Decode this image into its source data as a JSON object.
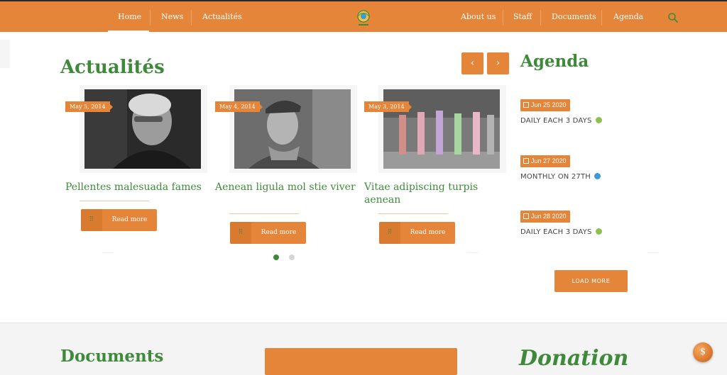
{
  "colors": {
    "brand_orange": "#e5853a",
    "title_green": "#3f8a3a",
    "dot_green": "#8fbf4f",
    "dot_blue": "#3e9ad1"
  },
  "nav": {
    "left": [
      "Home",
      "News",
      "Actualités"
    ],
    "right": [
      "About us",
      "Staff",
      "Documents",
      "Agenda"
    ],
    "search_icon": "search-icon",
    "logo_icon": "emblem-logo"
  },
  "news": {
    "title": "Actualités",
    "prev_icon": "chevron-left-icon",
    "next_icon": "chevron-right-icon",
    "prev_glyph": "‹",
    "next_glyph": "›",
    "cards": [
      {
        "date": "May 5, 2014",
        "title": "Pellentes malesuada fames",
        "button": "Read more"
      },
      {
        "date": "May 4, 2014",
        "title": "Aenean ligula mol stie viver",
        "button": "Read more"
      },
      {
        "date": "May 3, 2014",
        "title": "Vitae adipiscing turpis aenean",
        "button": "Read more"
      }
    ],
    "carousel_pages": 2,
    "active_page": 1
  },
  "agenda": {
    "title": "Agenda",
    "events": [
      {
        "date": "Jun 25 2020",
        "recurrence": "DAILY EACH 3 DAYS",
        "dot_color": "#8fbf4f"
      },
      {
        "date": "Jun 27 2020",
        "recurrence": "MONTHLY ON 27TH",
        "dot_color": "#3e9ad1"
      },
      {
        "date": "Jun 28 2020",
        "recurrence": "DAILY EACH 3 DAYS",
        "dot_color": "#8fbf4f"
      }
    ],
    "load_more": "LOAD MORE"
  },
  "bottom": {
    "documents_title": "Documents",
    "donation_title": "Donation",
    "fab_glyph": "$"
  }
}
